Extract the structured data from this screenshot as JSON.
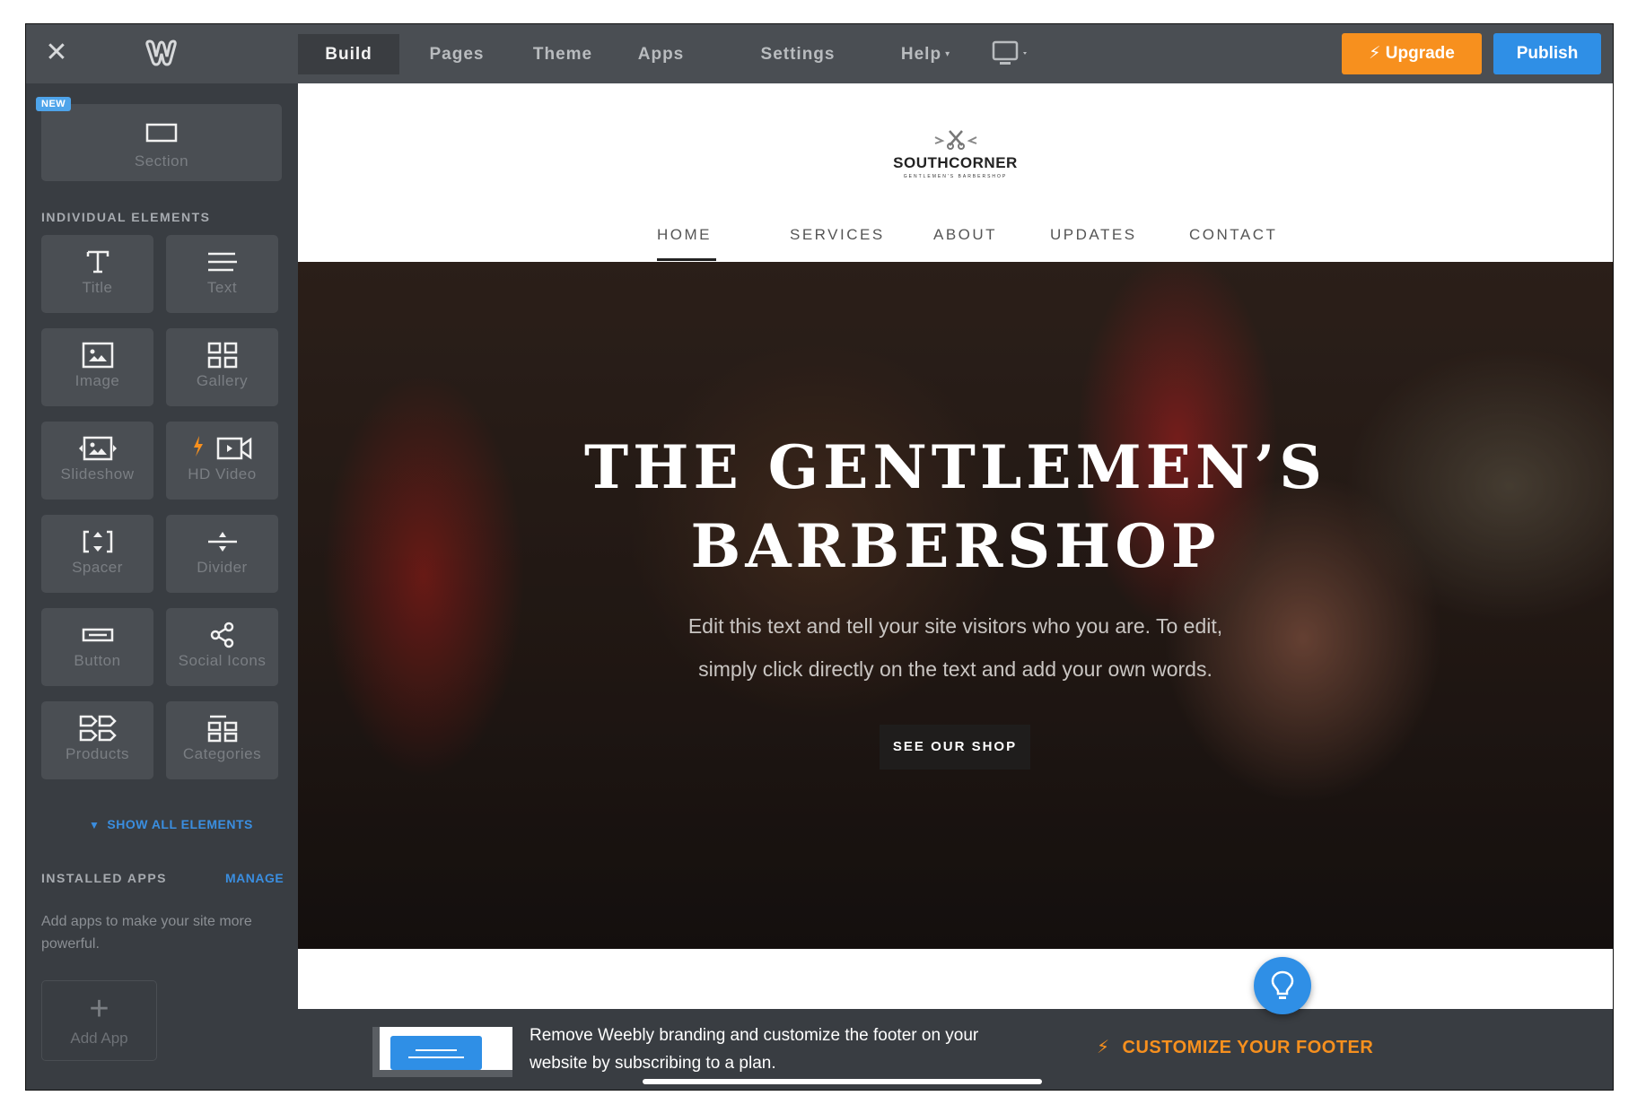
{
  "topbar": {
    "tabs": [
      {
        "label": "Build",
        "active": true
      },
      {
        "label": "Pages"
      },
      {
        "label": "Theme"
      },
      {
        "label": "Apps"
      },
      {
        "label": "Settings"
      },
      {
        "label": "Help"
      }
    ],
    "upgrade_label": "Upgrade",
    "publish_label": "Publish",
    "colors": {
      "upgrade": "#f7901e",
      "publish": "#2f8fe6"
    }
  },
  "sidebar": {
    "section_tile": {
      "label": "Section",
      "badge": "NEW"
    },
    "elements_heading": "INDIVIDUAL ELEMENTS",
    "elements": [
      {
        "label": "Title",
        "icon": "title-icon"
      },
      {
        "label": "Text",
        "icon": "text-icon"
      },
      {
        "label": "Image",
        "icon": "image-icon"
      },
      {
        "label": "Gallery",
        "icon": "gallery-icon"
      },
      {
        "label": "Slideshow",
        "icon": "slideshow-icon"
      },
      {
        "label": "HD Video",
        "icon": "video-icon",
        "premium": true
      },
      {
        "label": "Spacer",
        "icon": "spacer-icon"
      },
      {
        "label": "Divider",
        "icon": "divider-icon"
      },
      {
        "label": "Button",
        "icon": "button-icon"
      },
      {
        "label": "Social Icons",
        "icon": "share-icon"
      },
      {
        "label": "Products",
        "icon": "products-icon"
      },
      {
        "label": "Categories",
        "icon": "categories-icon"
      }
    ],
    "show_all_label": "SHOW ALL ELEMENTS",
    "apps_heading": "INSTALLED APPS",
    "manage_label": "MANAGE",
    "apps_description": "Add apps to make your site more powerful.",
    "add_app_label": "Add App"
  },
  "site": {
    "brand_name": "SOUTHCORNER",
    "brand_tagline": "GENTLEMEN'S BARBERSHOP",
    "nav": [
      "HOME",
      "SERVICES",
      "ABOUT",
      "UPDATES",
      "CONTACT"
    ],
    "active_nav": "HOME",
    "hero": {
      "title_line1": "THE GENTLEMEN’S",
      "title_line2": "BARBERSHOP",
      "text_line1": "Edit this text and tell your site visitors who you are. To edit,",
      "text_line2": "simply click directly on the text and add your own words.",
      "button_label": "SEE OUR SHOP"
    }
  },
  "footer_banner": {
    "message_line1": "Remove Weebly branding and customize the footer on your",
    "message_line2": "website by subscribing to a plan.",
    "cta_label": "CUSTOMIZE YOUR FOOTER"
  }
}
